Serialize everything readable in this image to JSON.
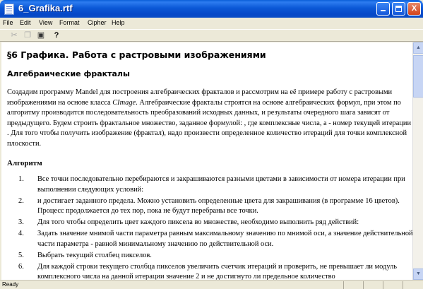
{
  "window": {
    "title": "6_Grafika.rtf",
    "controls": {
      "minimize": "",
      "maximize": "",
      "close": "X"
    }
  },
  "menu": {
    "items": [
      "File",
      "Edit",
      "View",
      "Format",
      "Cipher",
      "Help"
    ]
  },
  "toolbar": {
    "tools": [
      {
        "name": "cut-icon",
        "glyph": "✂"
      },
      {
        "name": "copy-icon",
        "glyph": "❐"
      },
      {
        "name": "paste-icon",
        "glyph": "▣"
      },
      {
        "name": "help-icon",
        "glyph": "?"
      }
    ]
  },
  "document": {
    "heading": "§6 Графика. Работа с растровыми изображениями",
    "subheading": "Алгебраические фракталы",
    "paragraph": {
      "before_italic": "Создадим программу Mandel для построения алгебраических фракталов и рассмотрим на её примере работу с растровыми изображениями на основе класса ",
      "italic": "CImage",
      "after_italic": ". Алгебраические фракталы строятся на основе алгебраических формул, при этом по алгоритму производится последовательность преобразований исходных данных, и результаты очередного шага зависят от предыдущего. Будем строить фрактальное множество, заданное формулой: , где комплексные числа, а  - номер текущей итерации . Для того чтобы получить изображение (фрактал), надо произвести определенное количество итераций для точки  комплексной плоскости."
    },
    "algorithm_heading": "Алгоритм",
    "algorithm_steps": [
      {
        "num": "1.",
        "text": "Все точки  последовательно перебираются и закрашиваются разными цветами в зависимости от номера итерации при выполнении следующих условий:"
      },
      {
        "num": "2.",
        "text": " и  достигает заданного предела. Можно установить определенные цвета для закрашивания (в программе 16 цветов). Процесс продолжается до тех пор, пока не будут перебраны все точки."
      },
      {
        "num": "3.",
        "text": "Для того чтобы определить цвет каждого пиксела во множестве, необходимо выполнить ряд действий:"
      },
      {
        "num": "4.",
        "text": "Задать значение мнимой части параметра  равным максимальному значению по мнимой оси, а значение действительной части параметра  - равной минимальному значению по действительной оси."
      },
      {
        "num": "5.",
        "text": "Выбрать текущий столбец пикселов."
      },
      {
        "num": "6.",
        "text": "Для каждой строки текущего столбца пикселов увеличить счетчик итераций и проверить, не превышает ли модуль комплексного числа на данной итерации значение 2 и не достигнуто ли предельное количество"
      }
    ]
  },
  "status": {
    "text": "Ready"
  }
}
